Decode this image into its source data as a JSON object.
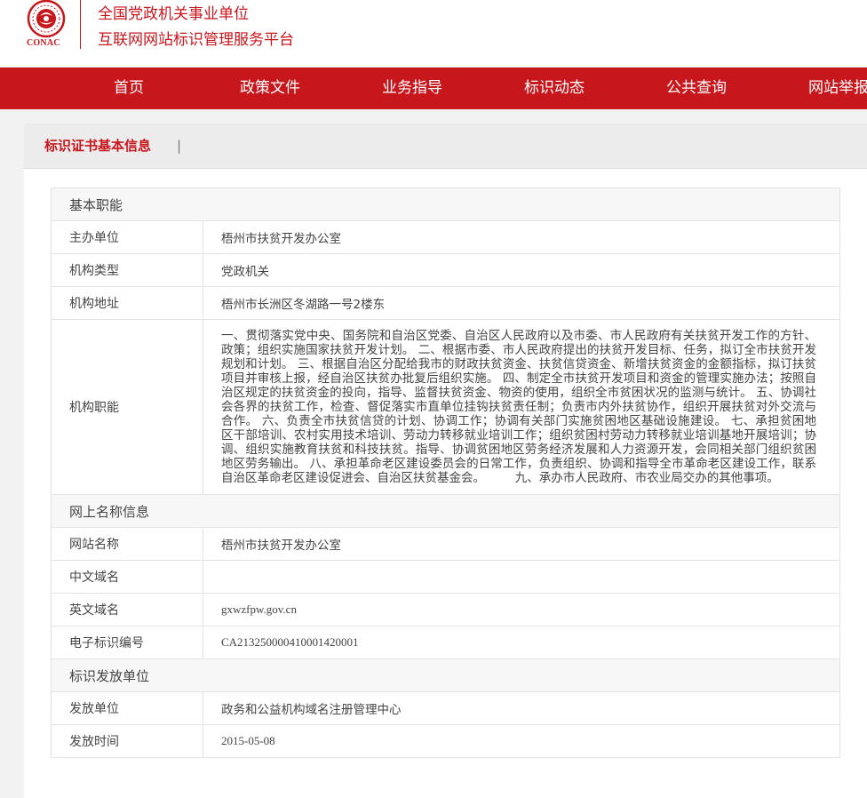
{
  "header": {
    "logo_text": "CONAC",
    "title_line1": "全国党政机关事业单位",
    "title_line2": "互联网网站标识管理服务平台",
    "brand_color": "#c8161d"
  },
  "nav": {
    "items": [
      "首页",
      "政策文件",
      "业务指导",
      "标识动态",
      "公共查询",
      "网站举报"
    ]
  },
  "section": {
    "title": "标识证书基本信息",
    "separator": "|"
  },
  "groups": {
    "basic": "基本职能",
    "online": "网上名称信息",
    "issuer": "标识发放单位"
  },
  "rows": {
    "sponsor": {
      "label": "主办单位",
      "value": "梧州市扶贫开发办公室"
    },
    "org_type": {
      "label": "机构类型",
      "value": "党政机关"
    },
    "address": {
      "label": "机构地址",
      "value": "梧州市长洲区冬湖路一号2楼东"
    },
    "duties": {
      "label": "机构职能",
      "value": "一、贯彻落实党中央、国务院和自治区党委、自治区人民政府以及市委、市人民政府有关扶贫开发工作的方针、政策；组织实施国家扶贫开发计划。 二、根据市委、市人民政府提出的扶贫开发目标、任务，拟订全市扶贫开发规划和计划。 三、根据自治区分配给我市的财政扶贫资金、扶贫信贷资金、新增扶贫资金的金额指标，拟订扶贫项目并审核上报，经自治区扶贫办批复后组织实施。 四、制定全市扶贫开发项目和资金的管理实施办法；按照自治区规定的扶贫资金的投向，指导、监督扶贫资金、物资的使用，组织全市贫困状况的监测与统计。 五、协调社会各界的扶贫工作，检查、督促落实市直单位挂钩扶贫责任制；负责市内外扶贫协作，组织开展扶贫对外交流与合作。 六、负责全市扶贫信贷的计划、协调工作；协调有关部门实施贫困地区基础设施建设。 七、承担贫困地区干部培训、农村实用技术培训、劳动力转移就业培训工作；组织贫困村劳动力转移就业培训基地开展培训；协调、组织实施教育扶贫和科技扶贫。指导、协调贫困地区劳务经济发展和人力资源开发，会同相关部门组织贫困地区劳务输出。 八、承担革命老区建设委员会的日常工作，负责组织、协调和指导全市革命老区建设工作，联系自治区革命老区建设促进会、自治区扶贫基金会。　　　九、承办市人民政府、市农业局交办的其他事项。"
    },
    "site_name": {
      "label": "网站名称",
      "value": "梧州市扶贫开发办公室"
    },
    "cn_domain": {
      "label": "中文域名",
      "value": ""
    },
    "en_domain": {
      "label": "英文域名",
      "value": "gxwzfpw.gov.cn"
    },
    "cert_no": {
      "label": "电子标识编号",
      "value": "CA213250000410001420001"
    },
    "issuer_unit": {
      "label": "发放单位",
      "value": "政务和公益机构域名注册管理中心"
    },
    "issue_date": {
      "label": "发放时间",
      "value": "2015-05-08"
    }
  }
}
